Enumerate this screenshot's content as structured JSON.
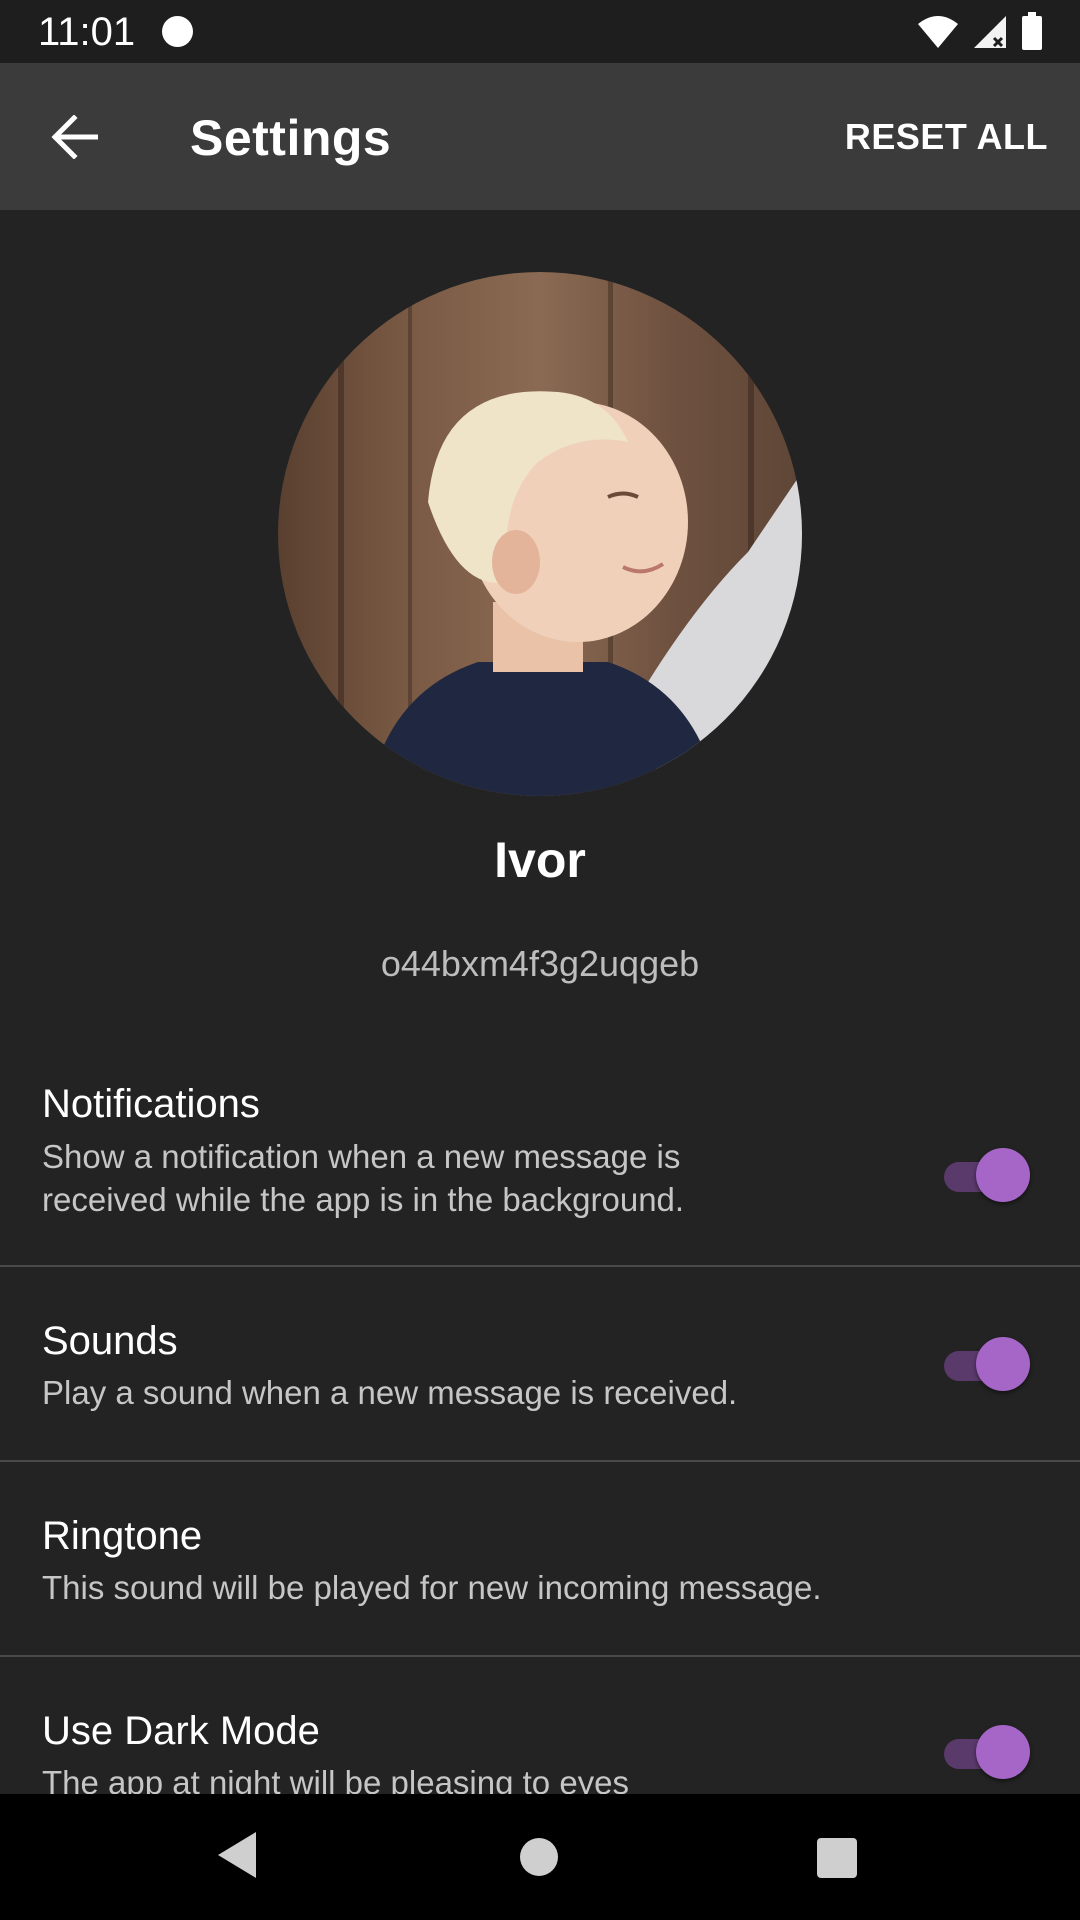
{
  "status_bar": {
    "time": "11:01"
  },
  "app_bar": {
    "title": "Settings",
    "reset_label": "RESET ALL"
  },
  "profile": {
    "name": "Ivor",
    "id": "o44bxm4f3g2uqgeb"
  },
  "settings": [
    {
      "title": "Notifications",
      "description": "Show a notification when a new message is received while the app is in the background.",
      "toggle_on": true
    },
    {
      "title": "Sounds",
      "description": "Play a sound when a new message is received.",
      "toggle_on": true
    },
    {
      "title": "Ringtone",
      "description": "This sound will be played for new incoming message."
    },
    {
      "title": "Use Dark Mode",
      "description": "The app at night will be pleasing to eyes",
      "toggle_on": true
    }
  ],
  "colors": {
    "background": "#232323",
    "app_bar": "#3b3b3b",
    "accent": "#a566c8",
    "accent_track": "#5a3a6b"
  },
  "icons": {
    "back": "arrow-left-icon",
    "wifi": "wifi-icon",
    "signal": "signal-icon",
    "battery": "battery-icon",
    "nav_back": "triangle-back-icon",
    "nav_home": "circle-home-icon",
    "nav_recent": "square-recents-icon"
  }
}
